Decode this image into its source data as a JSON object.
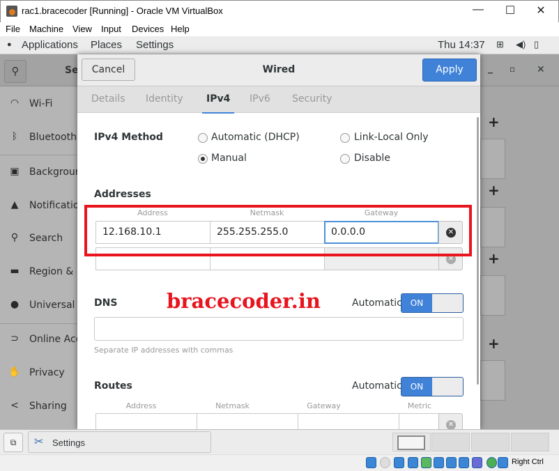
{
  "window": {
    "title": "rac1.bracecoder [Running] - Oracle VM VirtualBox",
    "minimize": "—",
    "maximize": "☐",
    "close": "✕"
  },
  "menu": [
    "File",
    "Machine",
    "View",
    "Input",
    "Devices",
    "Help"
  ],
  "topbar": {
    "applications": "Applications",
    "places": "Places",
    "settings": "Settings",
    "clock": "Thu 14:37"
  },
  "settings_header": {
    "title_partial": "Se",
    "minimize": "_",
    "restore": "▫",
    "close": "✕"
  },
  "sidebar": {
    "items": [
      {
        "label": "Wi-Fi",
        "icon": "wifi-icon"
      },
      {
        "label": "Bluetooth",
        "icon": "bluetooth-icon"
      },
      {
        "label": "Background",
        "icon": "background-icon"
      },
      {
        "label": "Notifications",
        "icon": "bell-icon"
      },
      {
        "label": "Search",
        "icon": "search-icon"
      },
      {
        "label": "Region & Language",
        "icon": "region-icon"
      },
      {
        "label": "Universal Access",
        "icon": "accessibility-icon"
      },
      {
        "label": "Online Accounts",
        "icon": "online-accounts-icon"
      },
      {
        "label": "Privacy",
        "icon": "hand-icon"
      },
      {
        "label": "Sharing",
        "icon": "share-icon"
      }
    ]
  },
  "dialog": {
    "cancel": "Cancel",
    "title": "Wired",
    "apply": "Apply",
    "tabs": [
      {
        "label": "Details"
      },
      {
        "label": "Identity"
      },
      {
        "label": "IPv4",
        "active": true
      },
      {
        "label": "IPv6"
      },
      {
        "label": "Security"
      }
    ],
    "ipv4_method_label": "IPv4 Method",
    "methods": {
      "dhcp": "Automatic (DHCP)",
      "link_local": "Link-Local Only",
      "manual": "Manual",
      "disable": "Disable",
      "selected": "Manual"
    },
    "addresses": {
      "heading": "Addresses",
      "columns": [
        "Address",
        "Netmask",
        "Gateway"
      ],
      "rows": [
        {
          "address": "12.168.10.1",
          "netmask": "255.255.255.0",
          "gateway": "0.0.0.0"
        },
        {
          "address": "",
          "netmask": "",
          "gateway": ""
        }
      ]
    },
    "dns": {
      "heading": "DNS",
      "automatic_label": "Automatic",
      "toggle": "ON",
      "value": "",
      "hint": "Separate IP addresses with commas"
    },
    "routes": {
      "heading": "Routes",
      "automatic_label": "Automatic",
      "toggle": "ON",
      "columns": [
        "Address",
        "Netmask",
        "Gateway",
        "Metric"
      ]
    }
  },
  "watermark": "bracecoder.in",
  "taskbar": {
    "settings": "Settings"
  },
  "statusbar": {
    "host_key": "Right Ctrl"
  },
  "colors": {
    "accent": "#3f82d8",
    "highlight_box": "#e8141e",
    "watermark": "#e8141e"
  }
}
